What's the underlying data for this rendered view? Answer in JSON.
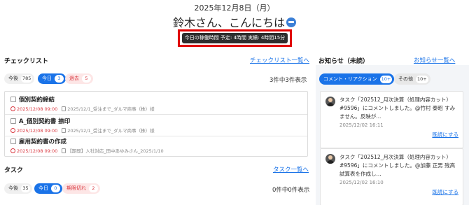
{
  "header": {
    "date": "2025年12月8日（月）",
    "greeting": "鈴木さん、こんにちは",
    "worktime": "今日の稼働時間 予定: 4時間 実績: 4時間15分"
  },
  "checklist": {
    "title": "チェックリスト",
    "link": "チェックリスト一覧へ",
    "filters": [
      {
        "label": "今後",
        "count": "785"
      },
      {
        "label": "今日",
        "count": "3"
      },
      {
        "label": "過去",
        "count": "5"
      }
    ],
    "showing": "3件中3件表示",
    "items": [
      {
        "title": "個別契約締結",
        "due": "2025/12/08 09:00",
        "source": "2025/12/1_受注まで_ダルマ商事（株）様"
      },
      {
        "title": "A_個別契約書 捺印",
        "due": "2025/12/08 09:00",
        "source": "2025/12/1_受注まで_ダルマ商事（株）様"
      },
      {
        "title": "雇用契約書の作成",
        "due": "2025/12/08 09:00",
        "source": "【期間】入社対応_田中あゆみさん_2025/1/10"
      }
    ]
  },
  "tasks": {
    "title": "タスク",
    "link": "タスク一覧へ",
    "filters": [
      {
        "label": "今後",
        "count": "35"
      },
      {
        "label": "今日",
        "count": "0"
      },
      {
        "label": "期限切れ",
        "count": "2"
      }
    ],
    "showing": "0件中0件表示"
  },
  "notices": {
    "title": "お知らせ（未読）",
    "link": "お知らせ一覧へ",
    "filters": [
      {
        "label": "コメント・リアクション",
        "count": "10+"
      },
      {
        "label": "その他",
        "count": "10+"
      }
    ],
    "items": [
      {
        "text": "タスク「202512_月次決算（処理内容カット）#9596」にコメントしました。@竹村 泰昭 すみません。反映が...",
        "date": "2025/12/02 16:11",
        "action": "既読にする"
      },
      {
        "text": "タスク「202512_月次決算（処理内容カット）#9596」にコメントしました。@加藤 正男 残高試算表を作成し...",
        "date": "2025/12/02 16:10",
        "action": "既読にする"
      }
    ]
  },
  "colors": {
    "accent": "#1a73e8",
    "danger": "#d9363e",
    "highlight": "#e00000"
  }
}
